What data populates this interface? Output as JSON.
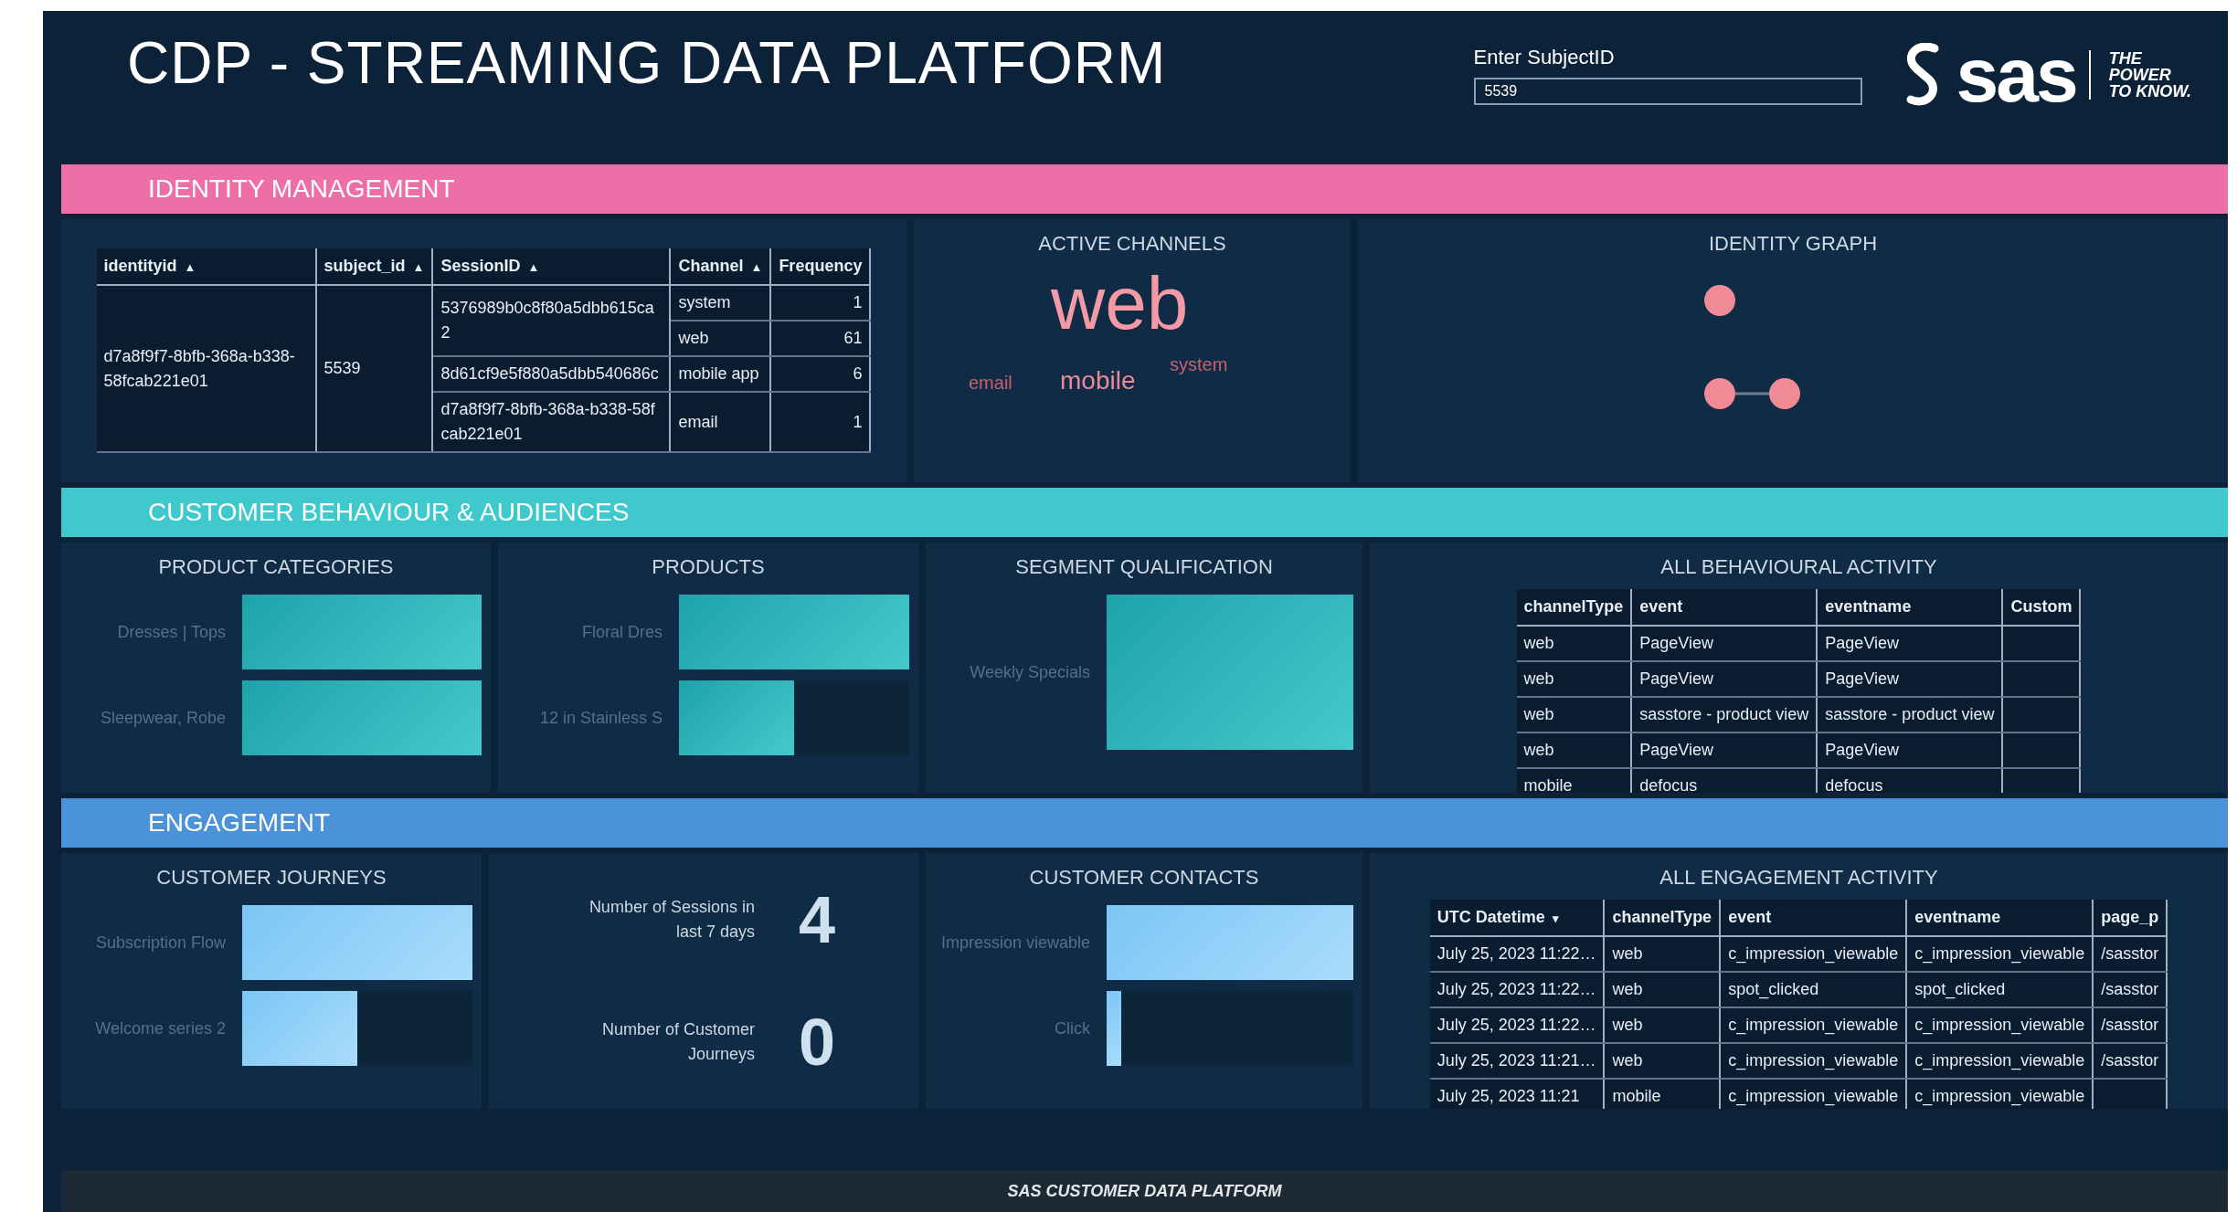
{
  "header": {
    "title": "CDP - STREAMING DATA PLATFORM",
    "subject_field": {
      "label": "Enter SubjectID",
      "value": "5539"
    },
    "logo": {
      "brand": "sas",
      "tagline": [
        "THE",
        "POWER",
        "TO KNOW."
      ]
    }
  },
  "sections": [
    {
      "kind": "identity",
      "title": "IDENTITY MANAGEMENT",
      "color": "#ee6fa8",
      "identity_table": {
        "columns": [
          {
            "label": "identityid",
            "sort_icon": "▲"
          },
          {
            "label": "subject_id",
            "sort_icon": "▲"
          },
          {
            "label": "SessionID",
            "sort_icon": "▲"
          },
          {
            "label": "Channel",
            "sort_icon": "▲"
          },
          {
            "label": "Frequency"
          }
        ],
        "identityid": "d7a8f9f7-8bfb-368a-b338-58fcab221e01",
        "subject_id": "5539",
        "sessions": [
          {
            "id": "5376989b0c8f80a5dbb615ca2",
            "channels": [
              {
                "channel": "system",
                "frequency": "1"
              },
              {
                "channel": "web",
                "frequency": "61"
              }
            ]
          },
          {
            "id": "8d61cf9e5f880a5dbb540686c",
            "channels": [
              {
                "channel": "mobile app",
                "frequency": "6"
              }
            ]
          },
          {
            "id": "d7a8f9f7-8bfb-368a-b338-58fcab221e01",
            "channels": [
              {
                "channel": "email",
                "frequency": "1"
              }
            ]
          }
        ]
      },
      "active_channels": {
        "title": "ACTIVE CHANNELS",
        "words": [
          {
            "text": "web",
            "kind": "large"
          },
          {
            "text": "email",
            "kind": "small"
          },
          {
            "text": "mobile",
            "kind": "medium"
          },
          {
            "text": "system",
            "kind": "small"
          }
        ]
      },
      "identity_graph": {
        "title": "IDENTITY GRAPH"
      }
    },
    {
      "kind": "behaviour",
      "title": "CUSTOMER BEHAVIOUR & AUDIENCES",
      "color": "#3fc9cc",
      "bar_panels": [
        {
          "title": "PRODUCT CATEGORIES",
          "bars": [
            {
              "label": "Dresses | Tops",
              "level": 1
            },
            {
              "label": "Sleepwear, Robe",
              "level": 1
            }
          ]
        },
        {
          "title": "PRODUCTS",
          "bars": [
            {
              "label": "Floral Dres",
              "level": 1
            },
            {
              "label": "12 in Stainless S",
              "level": 0.5
            }
          ]
        },
        {
          "title": "SEGMENT QUALIFICATION",
          "bars": [
            {
              "label": "Weekly Specials",
              "level": 1
            }
          ]
        }
      ],
      "table": {
        "title": "ALL BEHAVIOURAL ACTIVITY",
        "columns": [
          {
            "label": "channelType"
          },
          {
            "label": "event"
          },
          {
            "label": "eventname"
          },
          {
            "label": "Custom"
          }
        ],
        "rows": [
          [
            "web",
            "PageView",
            "PageView",
            ""
          ],
          [
            "web",
            "PageView",
            "PageView",
            ""
          ],
          [
            "web",
            "sasstore - product view",
            "sasstore - product view",
            ""
          ],
          [
            "web",
            "PageView",
            "PageView",
            ""
          ],
          [
            "mobile",
            "defocus",
            "defocus",
            ""
          ]
        ]
      }
    },
    {
      "kind": "engagement",
      "title": "ENGAGEMENT",
      "color": "#4c92d8",
      "bar_panels": [
        {
          "title": "CUSTOMER JOURNEYS",
          "bars": [
            {
              "label": "Subscription Flow",
              "level": 1
            },
            {
              "label": "Welcome series 2",
              "level": 0.5
            }
          ]
        }
      ],
      "stats": [
        {
          "label": "Number of Sessions in last 7 days",
          "value": "4"
        },
        {
          "label": "Number of Customer Journeys",
          "value": "0"
        }
      ],
      "contacts": {
        "title": "CUSTOMER CONTACTS",
        "bars": [
          {
            "label": "Impression viewable",
            "level": 1
          },
          {
            "label": "Click",
            "level": 0.06
          }
        ]
      },
      "table": {
        "title": "ALL ENGAGEMENT ACTIVITY",
        "columns": [
          {
            "label": "UTC Datetime",
            "sort_icon": "▾"
          },
          {
            "label": "channelType"
          },
          {
            "label": "event"
          },
          {
            "label": "eventname"
          },
          {
            "label": "page_p"
          }
        ],
        "rows": [
          [
            "July 25, 2023 11:22…",
            "web",
            "c_impression_viewable",
            "c_impression_viewable",
            "/sasstor"
          ],
          [
            "July 25, 2023 11:22…",
            "web",
            "spot_clicked",
            "spot_clicked",
            "/sasstor"
          ],
          [
            "July 25, 2023 11:22…",
            "web",
            "c_impression_viewable",
            "c_impression_viewable",
            "/sasstor"
          ],
          [
            "July 25, 2023 11:21…",
            "web",
            "c_impression_viewable",
            "c_impression_viewable",
            "/sasstor"
          ],
          [
            "July 25, 2023 11:21",
            "mobile",
            "c_impression_viewable",
            "c_impression_viewable",
            ""
          ]
        ]
      }
    }
  ],
  "footer": {
    "text": "SAS CUSTOMER DATA PLATFORM"
  }
}
